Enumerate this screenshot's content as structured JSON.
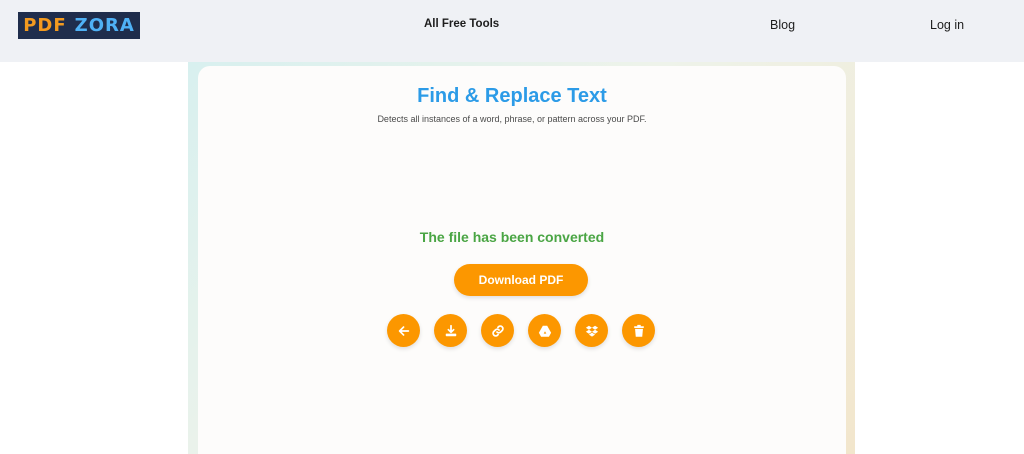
{
  "header": {
    "logo": {
      "part1": "PDF",
      "part2": "ZORA"
    },
    "nav": {
      "tools": "All Free Tools",
      "blog": "Blog",
      "login": "Log in"
    }
  },
  "main": {
    "title": "Find & Replace Text",
    "subtitle": "Detects all instances of a word, phrase, or pattern across your PDF.",
    "status": "The file has been converted",
    "download_label": "Download PDF",
    "actions": [
      "back-arrow-icon",
      "download-icon",
      "link-icon",
      "google-drive-icon",
      "dropbox-icon",
      "trash-icon"
    ]
  },
  "colors": {
    "accent": "#fc9700",
    "title": "#2c9be7",
    "success": "#4aa544",
    "logo_bg": "#1f2d4c"
  }
}
